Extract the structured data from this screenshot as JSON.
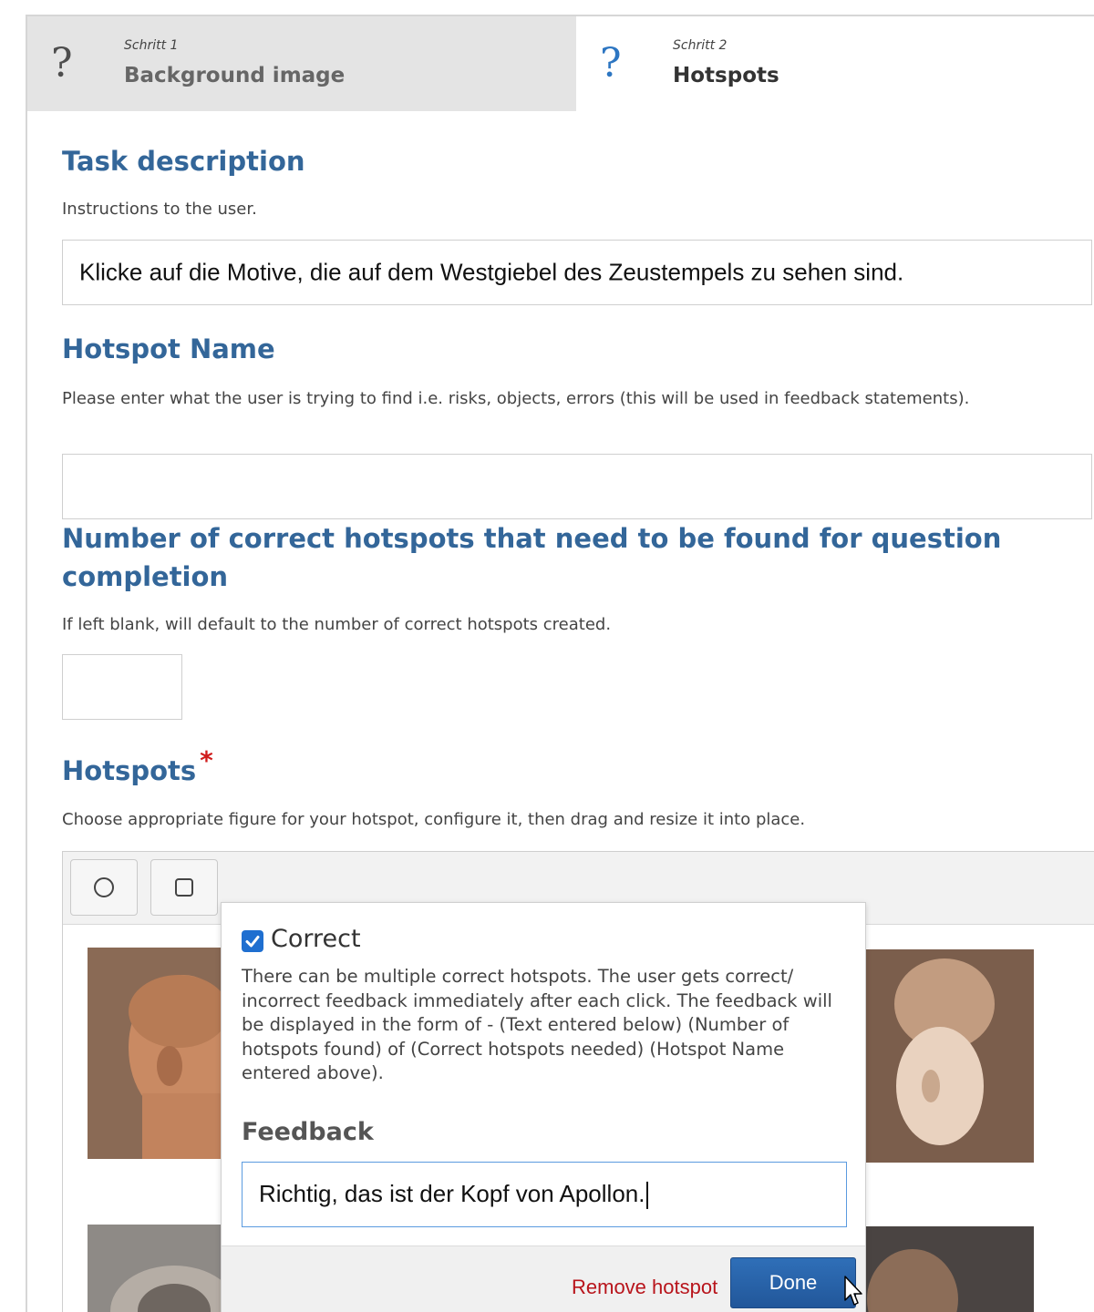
{
  "steps": [
    {
      "label": "Schritt 1",
      "title": "Background image",
      "icon": "question-icon"
    },
    {
      "label": "Schritt 2",
      "title": "Hotspots",
      "icon": "question-icon"
    }
  ],
  "task": {
    "title": "Task description",
    "description": "Instructions to the user.",
    "value": "Klicke auf die Motive, die auf dem Westgiebel des Zeustempels zu sehen sind."
  },
  "hotspot_name": {
    "title": "Hotspot Name",
    "description": "Please enter what the user is trying to find i.e. risks, objects, errors (this will be used in feedback statements).",
    "value": ""
  },
  "required_count": {
    "title": "Number of correct hotspots that need to be found for question completion",
    "description": "If left blank, will default to the number of correct hotspots created.",
    "value": ""
  },
  "hotspots": {
    "title": "Hotspots",
    "required_mark": "*",
    "description": "Choose appropriate figure for your hotspot, configure it, then drag and resize it into place.",
    "tools": [
      "circle-icon",
      "square-icon"
    ]
  },
  "popup": {
    "correct_label": "Correct",
    "correct_checked": true,
    "correct_help": "There can be multiple correct hotspots. The user gets correct/ incorrect feedback immediately after each click. The feedback will be displayed in the form of - (Text entered below) (Number of hotspots found) of (Correct hotspots needed) (Hotspot Name entered above).",
    "feedback_label": "Feedback",
    "feedback_value": "Richtig, das ist der Kopf von Apollon.",
    "remove_label": "Remove hotspot",
    "done_label": "Done"
  },
  "colors": {
    "heading": "#336699",
    "accent": "#2d76c2",
    "danger": "#b8141b",
    "button": "#22579a"
  }
}
